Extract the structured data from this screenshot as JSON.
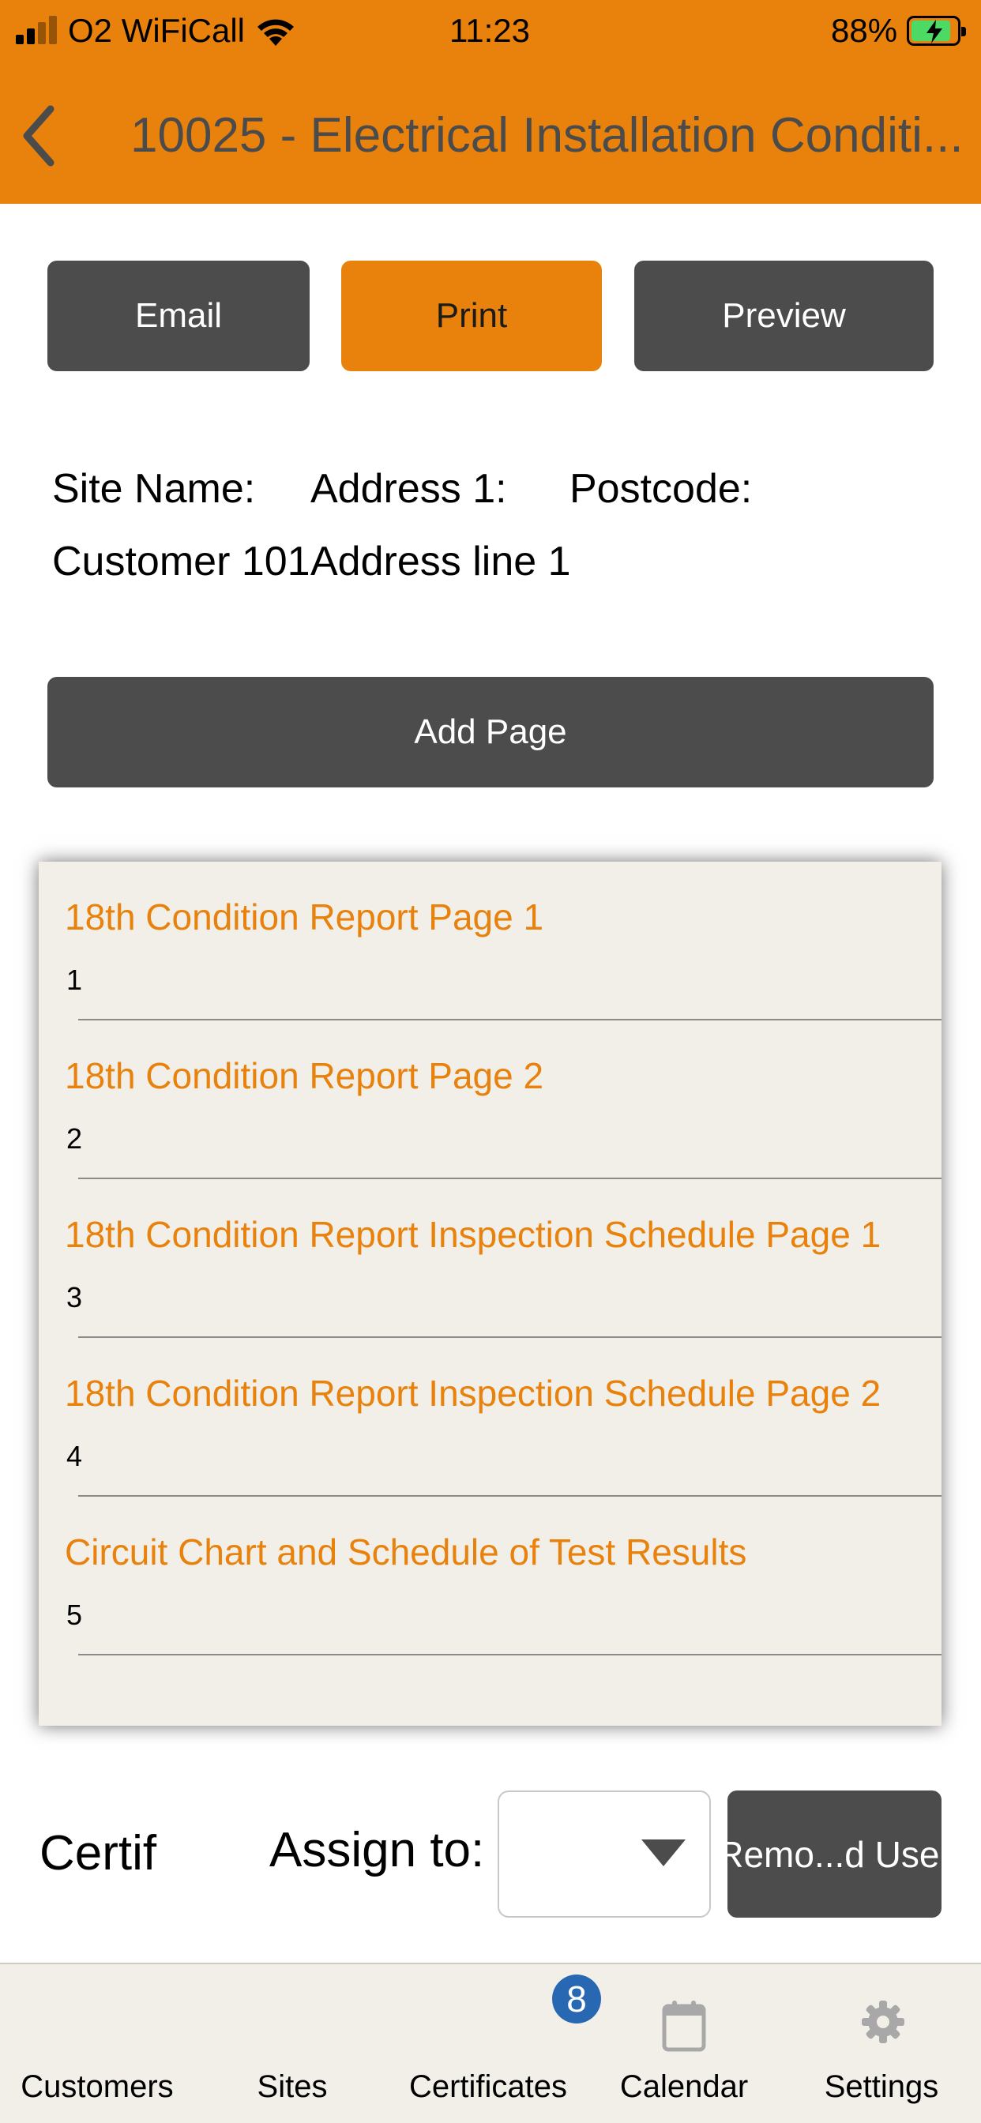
{
  "status_bar": {
    "carrier": "O2 WiFiCall",
    "time": "11:23",
    "battery_percent": "88%",
    "battery_level": 0.88,
    "charging": true
  },
  "header": {
    "back_icon": "chevron-left-icon",
    "title": "10025 - Electrical Installation Conditi..."
  },
  "actions": {
    "email_label": "Email",
    "print_label": "Print",
    "preview_label": "Preview"
  },
  "site_info": {
    "site_name_label": "Site Name:",
    "site_name_value": "Customer 101",
    "address_label": "Address 1:",
    "address_value": "Address line 1",
    "postcode_label": "Postcode:",
    "postcode_value": ""
  },
  "add_page_label": "Add Page",
  "pages": [
    {
      "name": "18th Condition Report Page 1",
      "number": "1"
    },
    {
      "name": "18th Condition Report Page 2",
      "number": "2"
    },
    {
      "name": "18th Condition Report Inspection Schedule Page 1",
      "number": "3"
    },
    {
      "name": "18th Condition Report Inspection Schedule Page 2",
      "number": "4"
    },
    {
      "name": "Circuit Chart and Schedule of Test Results",
      "number": "5"
    }
  ],
  "assign": {
    "certif_label": "Certif",
    "assign_label": "Assign to:",
    "selected_value": "",
    "remove_label": "Remo...d User"
  },
  "tabbar": {
    "customers": "Customers",
    "sites": "Sites",
    "certificates": "Certificates",
    "certificates_badge": "8",
    "calendar": "Calendar",
    "settings": "Settings"
  },
  "colors": {
    "accent": "#e8820c",
    "dark_button": "#4c4c4c",
    "list_background": "#f2efe9",
    "badge": "#2867b2"
  }
}
